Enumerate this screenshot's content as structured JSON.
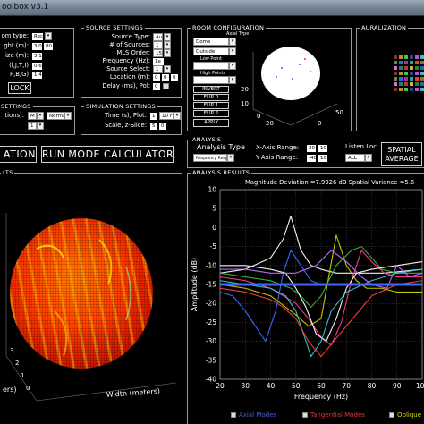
{
  "window": {
    "title": "oolbox v3.1"
  },
  "left_panel": {
    "rows": [
      {
        "label": "om type:",
        "value": "Rect"
      },
      {
        "label": "ght (m):",
        "value": "3.0"
      },
      {
        "label": "ize (m):",
        "value": "3.1"
      },
      {
        "label": "(l,J,T,I)",
        "value": "0.6"
      },
      {
        "label": "P,B,G)",
        "value": "1.4"
      }
    ],
    "extra_values": [
      "80",
      "80"
    ],
    "lock_label": "LOCK"
  },
  "source_settings": {
    "title": "SOURCE SETTINGS",
    "rows": [
      {
        "label": "Source Type:",
        "value": "Au"
      },
      {
        "label": "# of Sources:",
        "value": "1"
      },
      {
        "label": "MLS Order:",
        "value": "15"
      },
      {
        "label": "Frequency (Hz):",
        "value": "1e"
      },
      {
        "label": "Source Select:",
        "value": "1"
      },
      {
        "label": "Location (m):",
        "value": "0"
      },
      {
        "label": "Delay (ms), Pol:",
        "value": "0"
      }
    ],
    "location_values": [
      "0",
      "0"
    ]
  },
  "room_configuration": {
    "title": "ROOM CONFIGURATION",
    "axial_type_label": "Axial Type",
    "dome_label": "Dome",
    "outside_label": "Outside",
    "low_point_label": "Low Point",
    "high_point_label": "High Points",
    "buttons": [
      "INVERT",
      "FLIP 0",
      "FLIP 1",
      "FLIP 2",
      "APPLY"
    ],
    "axis_ticks": [
      "20",
      "10",
      "0",
      "50",
      "0",
      "20"
    ],
    "left_arrow": "←",
    "right_arrow": "→"
  },
  "auralization": {
    "title": "AURALIZATION"
  },
  "settings_panel": {
    "title": "SETTINGS",
    "rows": [
      {
        "label": "tions):",
        "value": "M",
        "value2": "Normal"
      },
      {
        "label": "",
        "value": "1"
      }
    ]
  },
  "simulation_settings": {
    "title": "SIMULATION SETTINGS",
    "rows": [
      {
        "label": "Time (s), Plot:",
        "value": "1",
        "value2": "10 Fi."
      },
      {
        "label": "Scale, z-Slice:",
        "value": "5",
        "value2": "0"
      }
    ]
  },
  "mode_buttons": {
    "left": "LATION",
    "run": "RUN MODE CALCULATOR"
  },
  "analysis": {
    "title": "ANALYSIS",
    "analysis_type_label": "Analysis Type",
    "analysis_type_value": "Frequency Resp...",
    "x_range_label": "X-Axis Range:",
    "x_range": [
      "20",
      "10"
    ],
    "y_range_label": "Y-Axis Range:",
    "y_range": [
      "-40",
      "10"
    ],
    "listen_label": "Listen Loc",
    "listen_value": "ALL",
    "spatial_label": "SPATIAL",
    "average_label": "AVERAGE"
  },
  "results_left": {
    "title": "LTS",
    "xlabel": "Width (meters)",
    "ylabel_partial": "ers)",
    "tick_labels": [
      "3",
      "2",
      "1",
      "0"
    ]
  },
  "analysis_results": {
    "title": "ANALYSIS RESULTS",
    "header": "Magnitude Deviation =7.9926 dB   Spatial Variance =5.6"
  },
  "legend": [
    {
      "label": "Axial Modes",
      "color": "#4a5fd6"
    },
    {
      "label": "Tangential Modes",
      "color": "#e03b3b"
    },
    {
      "label": "Oblique",
      "color": "#d8d800"
    }
  ],
  "chart_data": {
    "type": "line",
    "xlabel": "Frequency (Hz)",
    "ylabel": "Amplitude (dB)",
    "xlim": [
      20,
      100
    ],
    "ylim": [
      -40,
      10
    ],
    "x_ticks": [
      20,
      30,
      40,
      50,
      60,
      70,
      80,
      90,
      100
    ],
    "y_ticks": [
      10,
      5,
      0,
      -5,
      -10,
      -15,
      -20,
      -25,
      -30,
      -35,
      -40
    ],
    "grid": true,
    "legend_position": "bottom",
    "series": [
      {
        "color": "#ffffff",
        "x": [
          20,
          30,
          40,
          45,
          48,
          52,
          56,
          60,
          66,
          75,
          85,
          100
        ],
        "y": [
          -12,
          -11,
          -8,
          -3,
          3,
          -6,
          -10,
          -11,
          -12,
          -12,
          -12,
          -11
        ]
      },
      {
        "color": "#3f6bff",
        "x": [
          20,
          25,
          30,
          35,
          38,
          42,
          45,
          48,
          52,
          56,
          60,
          70,
          80,
          90,
          100
        ],
        "y": [
          -17,
          -18,
          -22,
          -27,
          -30,
          -22,
          -12,
          -6,
          -10,
          -14,
          -15,
          -15,
          -15,
          -15,
          -15
        ]
      },
      {
        "color": "#d0d000",
        "x": [
          20,
          30,
          40,
          50,
          55,
          60,
          63,
          66,
          70,
          74,
          78,
          84,
          90,
          100
        ],
        "y": [
          -15,
          -16,
          -18,
          -23,
          -26,
          -24,
          -13,
          -2,
          -10,
          -14,
          -16,
          -16,
          -17,
          -17
        ]
      },
      {
        "color": "#ff3b8e",
        "x": [
          20,
          30,
          40,
          50,
          55,
          60,
          64,
          68,
          72,
          76,
          80,
          85,
          90,
          100
        ],
        "y": [
          -13,
          -14,
          -16,
          -20,
          -24,
          -29,
          -31,
          -25,
          -14,
          -6,
          -9,
          -12,
          -13,
          -13
        ]
      },
      {
        "color": "#3cbb3c",
        "x": [
          20,
          30,
          40,
          48,
          52,
          56,
          60,
          66,
          72,
          76,
          80,
          84,
          90,
          100
        ],
        "y": [
          -12,
          -13,
          -14,
          -16,
          -18,
          -21,
          -18,
          -10,
          -6,
          -5,
          -8,
          -11,
          -12,
          -12
        ]
      },
      {
        "color": "#ffffff",
        "x": [
          20,
          30,
          40,
          46,
          50,
          54,
          58,
          62,
          66,
          70,
          74,
          80,
          90,
          100
        ],
        "y": [
          -10,
          -10,
          -11,
          -12,
          -16,
          -21,
          -28,
          -30,
          -24,
          -16,
          -12,
          -11,
          -10,
          -9
        ]
      },
      {
        "color": "#36c6d8",
        "x": [
          20,
          30,
          40,
          46,
          50,
          53,
          56,
          60,
          64,
          70,
          80,
          90,
          100
        ],
        "y": [
          -14,
          -15,
          -16,
          -18,
          -22,
          -28,
          -34,
          -30,
          -22,
          -17,
          -14,
          -12,
          -11
        ]
      },
      {
        "color": "#ff4040",
        "x": [
          20,
          30,
          40,
          45,
          50,
          55,
          60,
          70,
          80,
          90,
          100
        ],
        "y": [
          -16,
          -17,
          -19,
          -21,
          -24,
          -30,
          -34,
          -26,
          -18,
          -15,
          -14
        ]
      },
      {
        "color": "#c070ff",
        "x": [
          20,
          30,
          40,
          50,
          58,
          64,
          70,
          76,
          80,
          86,
          90,
          95,
          100
        ],
        "y": [
          -11,
          -11,
          -12,
          -12,
          -10,
          -6,
          -9,
          -13,
          -15,
          -16,
          -10,
          -13,
          -12
        ]
      },
      {
        "color": "#3f6bff",
        "x": [
          20,
          30,
          40,
          50,
          60,
          70,
          80,
          90,
          100
        ],
        "y": [
          -15,
          -15,
          -15,
          -15,
          -15,
          -15,
          -15,
          -15,
          -15
        ]
      }
    ]
  }
}
